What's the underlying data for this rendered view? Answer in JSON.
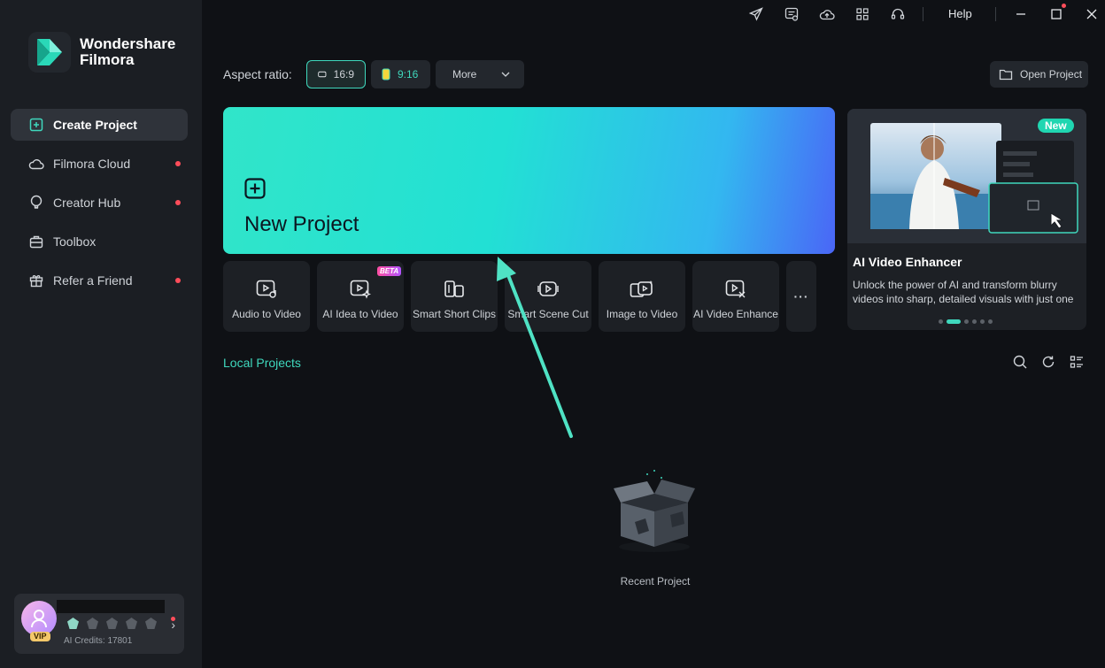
{
  "app": {
    "brand_line1": "Wondershare",
    "brand_line2": "Filmora"
  },
  "sidebar": {
    "items": [
      {
        "label": "Create Project",
        "icon": "create-project-icon",
        "active": true,
        "dot": false
      },
      {
        "label": "Filmora Cloud",
        "icon": "cloud-icon",
        "active": false,
        "dot": true
      },
      {
        "label": "Creator Hub",
        "icon": "lightbulb-icon",
        "active": false,
        "dot": true
      },
      {
        "label": "Toolbox",
        "icon": "toolbox-icon",
        "active": false,
        "dot": false
      },
      {
        "label": "Refer a Friend",
        "icon": "gift-icon",
        "active": false,
        "dot": true
      }
    ],
    "user": {
      "vip_label": "VIP",
      "credits": "AI Credits: 17801"
    }
  },
  "titlebar": {
    "help": "Help"
  },
  "aspect": {
    "label": "Aspect ratio:",
    "options": [
      "16:9",
      "9:16"
    ],
    "more": "More",
    "open_project": "Open Project"
  },
  "new_project": {
    "label": "New Project"
  },
  "features": [
    {
      "label": "Audio to Video",
      "icon": "audio-to-video-icon"
    },
    {
      "label": "AI Idea to Video",
      "icon": "ai-idea-icon",
      "badge": "BETA"
    },
    {
      "label": "Smart Short Clips",
      "icon": "short-clips-icon"
    },
    {
      "label": "Smart Scene Cut",
      "icon": "scene-cut-icon"
    },
    {
      "label": "Image to Video",
      "icon": "image-to-video-icon"
    },
    {
      "label": "AI Video Enhance",
      "icon": "video-enhance-icon"
    }
  ],
  "promo": {
    "badge": "New",
    "title": "AI Video Enhancer",
    "description": "Unlock the power of AI and transform blurry videos into sharp, detailed visuals with just one",
    "active_slide": 2,
    "slides": 6
  },
  "local": {
    "title": "Local Projects",
    "empty_label": "Recent Project"
  },
  "colors": {
    "accent": "#3fd8bd",
    "alert": "#ff4d5a"
  }
}
